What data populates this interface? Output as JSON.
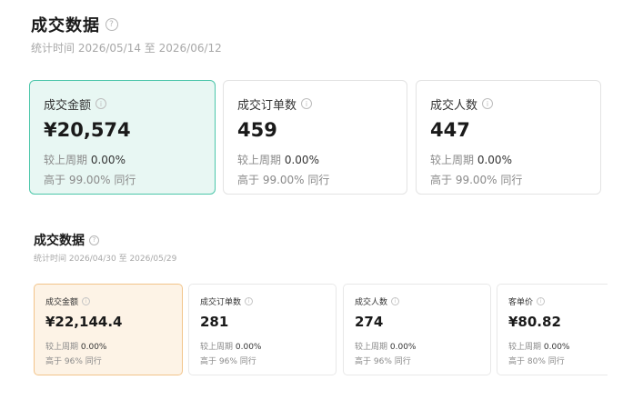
{
  "section1": {
    "title": "成交数据",
    "help_icon": "question-circle-icon",
    "subtitle": "统计时间 2026/05/14 至 2026/06/12",
    "cards": [
      {
        "label": "成交金额",
        "value": "¥20,574",
        "cmp_label": "较上周期",
        "cmp_value": "0.00%",
        "peer": "高于 99.00% 同行",
        "active": true
      },
      {
        "label": "成交订单数",
        "value": "459",
        "cmp_label": "较上周期",
        "cmp_value": "0.00%",
        "peer": "高于 99.00% 同行",
        "active": false
      },
      {
        "label": "成交人数",
        "value": "447",
        "cmp_label": "较上周期",
        "cmp_value": "0.00%",
        "peer": "高于 99.00% 同行",
        "active": false
      }
    ]
  },
  "section2": {
    "title": "成交数据",
    "help_icon": "question-circle-icon",
    "subtitle": "统计时间 2026/04/30 至 2026/05/29",
    "cards": [
      {
        "label": "成交金额",
        "value": "¥22,144.4",
        "cmp_label": "较上周期",
        "cmp_value": "0.00%",
        "peer": "高于 96% 同行",
        "active": true
      },
      {
        "label": "成交订单数",
        "value": "281",
        "cmp_label": "较上周期",
        "cmp_value": "0.00%",
        "peer": "高于 96% 同行",
        "active": false
      },
      {
        "label": "成交人数",
        "value": "274",
        "cmp_label": "较上周期",
        "cmp_value": "0.00%",
        "peer": "高于 96% 同行",
        "active": false
      },
      {
        "label": "客单价",
        "value": "¥80.82",
        "cmp_label": "较上周期",
        "cmp_value": "0.00%",
        "peer": "高于 80% 同行",
        "active": false
      }
    ]
  },
  "colors": {
    "accent_green_border": "#4cc6aa",
    "accent_green_bg": "#e8f7f3",
    "accent_orange_border": "#f2c48a",
    "accent_orange_bg": "#fdf3e6"
  }
}
